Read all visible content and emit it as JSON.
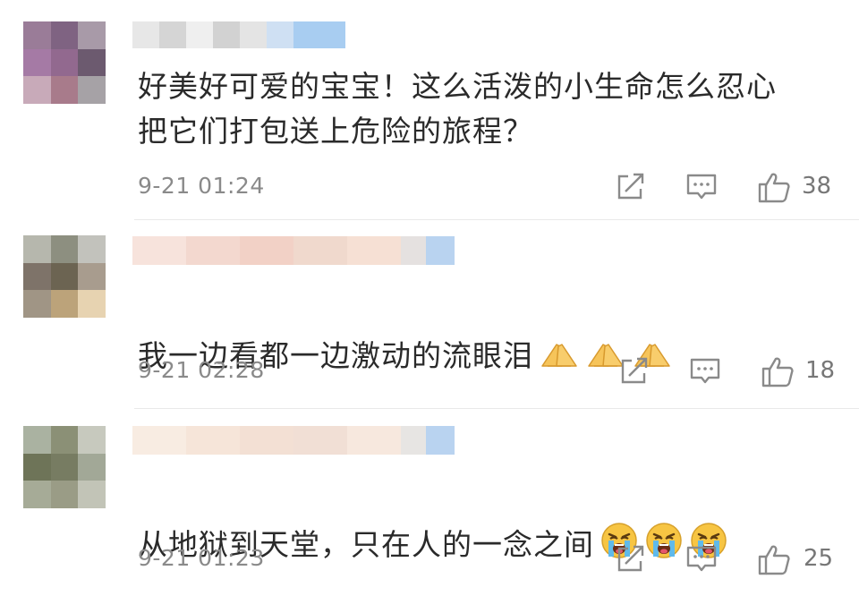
{
  "comments": [
    {
      "text": "好美好可爱的宝宝！这么活泼的小生命怎么忍心\n把它们打包送上危险的旅程？",
      "time": "9-21 01:24",
      "likes": "38",
      "emoji": [],
      "avatar_colors": [
        "#9a7c98",
        "#7f6382",
        "#a89aa8",
        "#a57aa5",
        "#92698f",
        "#6c5a6f",
        "#c8aab9",
        "#a87b8b",
        "#a6a2a6"
      ],
      "username_colors": [
        "#e7e7e7",
        "#d5d5d5",
        "#efefef",
        "#d2d2d2",
        "#e4e4e4",
        "#cfe0f3",
        "#a8cdf1"
      ]
    },
    {
      "text": "我一边看都一边激动的流眼泪",
      "time": "9-21 02:28",
      "likes": "18",
      "emoji": [
        "praying-hands-icon",
        "praying-hands-icon",
        "praying-hands-icon"
      ],
      "avatar_colors": [
        "#b6b7ad",
        "#8d8f80",
        "#c2c2bc",
        "#7e7369",
        "#6c6452",
        "#a89c8e",
        "#a09585",
        "#bca37a",
        "#e7d3b1"
      ],
      "username_colors": [
        "#f7e3dc",
        "#f3d8cf",
        "#f2d1c6",
        "#f0d9cd",
        "#f6e0d4",
        "#e5e1e0",
        "#b9d3f0"
      ]
    },
    {
      "text": "从地狱到天堂，只在人的一念之间",
      "time": "9-21 01:23",
      "likes": "25",
      "emoji": [
        "loudly-crying-face-icon",
        "loudly-crying-face-icon",
        "loudly-crying-face-icon"
      ],
      "avatar_colors": [
        "#aab2a1",
        "#8b9076",
        "#c7c9be",
        "#6e7458",
        "#777c62",
        "#a2a897",
        "#a6ab97",
        "#9a9c86",
        "#c2c4b7"
      ],
      "username_colors": [
        "#f8ece2",
        "#f6e5d9",
        "#f3e0d4",
        "#f1dfd5",
        "#f7e8de",
        "#e7e5e3",
        "#b9d3f0"
      ]
    }
  ],
  "icons": {
    "share": "share-icon",
    "reply": "reply-icon",
    "like": "like-icon"
  }
}
